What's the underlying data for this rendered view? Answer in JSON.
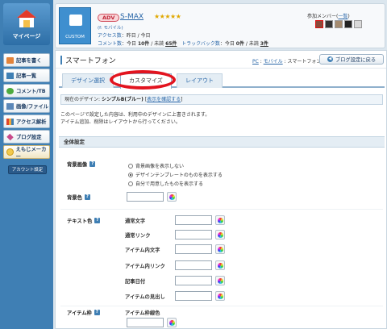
{
  "sidebar": {
    "mypage_label": "マイページ",
    "items": [
      {
        "label": "記事を書く",
        "icon": "pencil-icon",
        "color": "#e2833a"
      },
      {
        "label": "記事一覧",
        "icon": "list-icon",
        "color": "#3f7fb4"
      },
      {
        "label": "コメント/TB",
        "icon": "comment-icon",
        "color": "#4caa3f"
      },
      {
        "label": "画像/ファイル",
        "icon": "image-icon",
        "color": "#5a87b8"
      },
      {
        "label": "アクセス解析",
        "icon": "chart-icon",
        "color": "#e0452b"
      },
      {
        "label": "ブログ設定",
        "icon": "wrench-icon",
        "color": "#c94a8a"
      }
    ],
    "emoji_label": "えもじメーカー",
    "account_label": "アカウント設定"
  },
  "header": {
    "icon_caption": "CUSTOM",
    "badge": "ADV",
    "blog_name": "S-MAX",
    "stars": "★★★★★",
    "mobile_link": "(f: モバイル)",
    "access_label": "アクセス数",
    "access_value": "：昨日 / 今日",
    "comment_label": "コメント数",
    "comment_value": "：今日",
    "comment_today": "10件",
    "comment_unread_label": " / 未読 ",
    "comment_unread": "65件",
    "trackback_label": "トラックバック数",
    "trackback_value": "：今日",
    "trackback_today": "0件",
    "trackback_unread_label": " / 未読 ",
    "trackback_unread": "3件",
    "members_label": "参加メンバー",
    "members_link": "一覧"
  },
  "main": {
    "title": "スマートフォン",
    "crumb_pc": "PC",
    "crumb_mobile": "モバイル",
    "crumb_current": "スマートフォン",
    "back_button": "ブログ設定に戻る",
    "tabs": [
      {
        "label": "デザイン選択"
      },
      {
        "label": "カスタマイズ"
      },
      {
        "label": "レイアウト"
      }
    ],
    "current_design_label": "現在のデザイン: ",
    "current_design_name": "シンプルB(ブルー)",
    "current_design_link": "表示を確認する",
    "note_line1": "このページで設定した内容は、利用中のデザインに上書きされます。",
    "note_line2": "アイテム追加、削除はレイアウトから行ってください。",
    "section_title": "全体設定",
    "bg_image_label": "背景画像",
    "bg_options": [
      {
        "label": "背景画像を表示しない",
        "selected": false
      },
      {
        "label": "デザインテンプレートのものを表示する",
        "selected": true
      },
      {
        "label": "自分で用意したものを表示する",
        "selected": false
      }
    ],
    "bg_color_label": "背景色",
    "text_color_label": "テキスト色",
    "text_fields": [
      "通常文字",
      "通常リンク",
      "アイテム内文字",
      "アイテム内リンク",
      "記事日付",
      "アイテムの見出し"
    ],
    "item_frame_label": "アイテム枠",
    "item_frame_field": "アイテム枠線色"
  }
}
